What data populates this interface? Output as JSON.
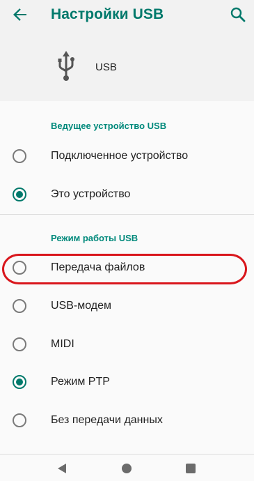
{
  "header": {
    "title": "Настройки USB",
    "back_icon": "arrow-left-icon",
    "search_icon": "search-icon"
  },
  "device": {
    "icon": "usb-icon",
    "label": "USB"
  },
  "host_section": {
    "title": "Ведущее устройство USB",
    "options": [
      {
        "label": "Подключенное устройство",
        "checked": false
      },
      {
        "label": "Это устройство",
        "checked": true
      }
    ]
  },
  "mode_section": {
    "title": "Режим работы USB",
    "options": [
      {
        "label": "Передача файлов",
        "checked": false,
        "highlighted": true
      },
      {
        "label": "USB-модем",
        "checked": false
      },
      {
        "label": "MIDI",
        "checked": false
      },
      {
        "label": "Режим PTP",
        "checked": true
      },
      {
        "label": "Без передачи данных",
        "checked": false
      }
    ]
  },
  "colors": {
    "accent": "#00796b",
    "highlight_outline": "#d9161c"
  },
  "navbar": {
    "back_icon": "nav-back-icon",
    "home_icon": "nav-home-icon",
    "recents_icon": "nav-recents-icon"
  }
}
